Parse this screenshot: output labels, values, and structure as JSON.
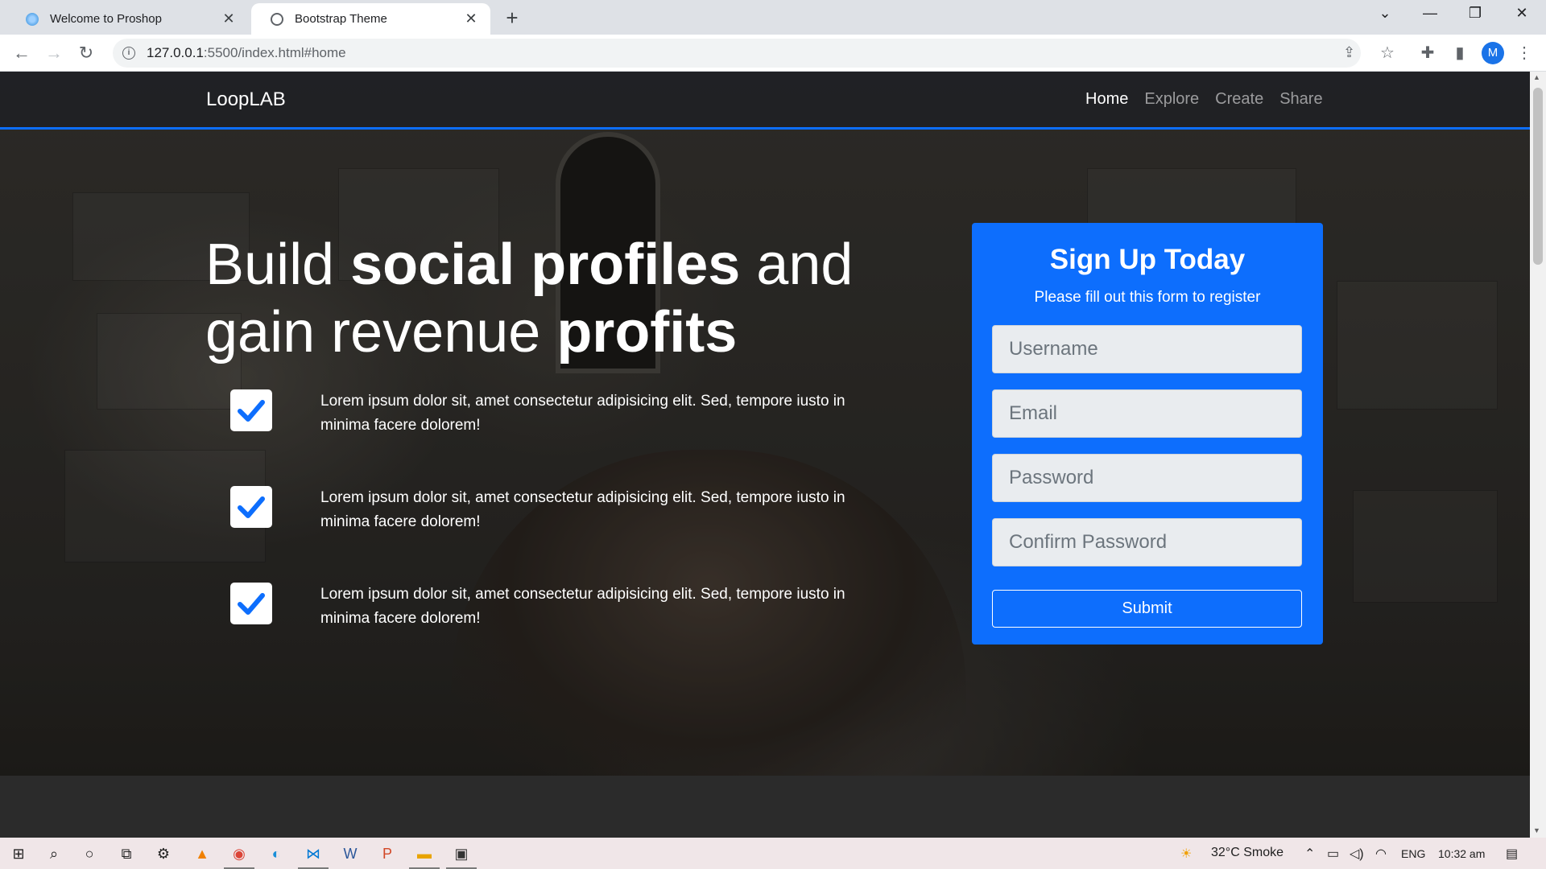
{
  "browser": {
    "tabs": [
      {
        "title": "Welcome to Proshop",
        "active": false,
        "icon": "proshop-favicon"
      },
      {
        "title": "Bootstrap Theme",
        "active": true,
        "icon": "globe-icon"
      }
    ],
    "url_host": "127.0.0.1",
    "url_rest": ":5500/index.html#home",
    "profile_initial": "M"
  },
  "navbar": {
    "brand": "LoopLAB",
    "links": [
      {
        "label": "Home",
        "active": true
      },
      {
        "label": "Explore",
        "active": false
      },
      {
        "label": "Create",
        "active": false
      },
      {
        "label": "Share",
        "active": false
      }
    ]
  },
  "hero": {
    "headline_1": "Build ",
    "headline_2": "social profiles",
    "headline_3": " and gain revenue ",
    "headline_4": "profits",
    "features": [
      "Lorem ipsum dolor sit, amet consectetur adipisicing elit. Sed, tempore iusto in minima facere dolorem!",
      "Lorem ipsum dolor sit, amet consectetur adipisicing elit. Sed, tempore iusto in minima facere dolorem!",
      "Lorem ipsum dolor sit, amet consectetur adipisicing elit. Sed, tempore iusto in minima facere dolorem!"
    ]
  },
  "signup": {
    "title": "Sign Up Today",
    "subtitle": "Please fill out this form to register",
    "username_placeholder": "Username",
    "email_placeholder": "Email",
    "password_placeholder": "Password",
    "confirm_placeholder": "Confirm Password",
    "submit_label": "Submit"
  },
  "taskbar": {
    "weather": "32°C  Smoke",
    "language": "ENG",
    "time": "10:32 am"
  },
  "colors": {
    "accent": "#0d6efd",
    "navbar_bg": "#1e2024",
    "check_color": "#0d6efd"
  }
}
